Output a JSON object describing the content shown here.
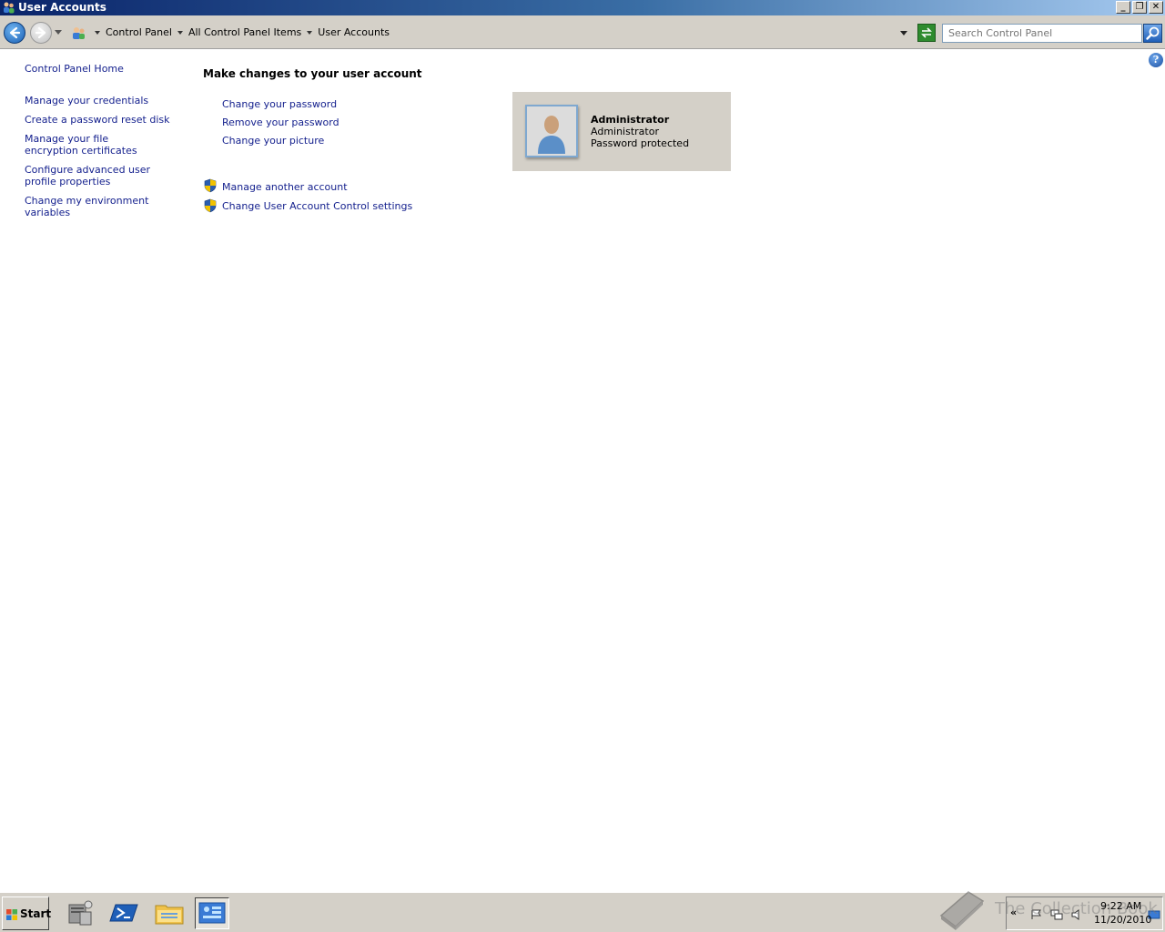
{
  "window": {
    "title": "User Accounts",
    "buttons": {
      "minimize": "_",
      "restore": "❐",
      "close": "✕"
    }
  },
  "address_bar": {
    "breadcrumbs": [
      "Control Panel",
      "All Control Panel Items",
      "User Accounts"
    ],
    "search_placeholder": "Search Control Panel"
  },
  "sidebar": {
    "home": "Control Panel Home",
    "items": [
      "Manage your credentials",
      "Create a password reset disk",
      "Manage your file encryption certificates",
      "Configure advanced user profile properties",
      "Change my environment variables"
    ]
  },
  "main": {
    "heading": "Make changes to your user account",
    "tasks": [
      "Change your password",
      "Remove your password",
      "Change your picture"
    ],
    "admin_tasks": [
      "Manage another account",
      "Change User Account Control settings"
    ]
  },
  "account": {
    "name": "Administrator",
    "role": "Administrator",
    "status": "Password protected"
  },
  "help": {
    "glyph": "?"
  },
  "taskbar": {
    "start_label": "Start",
    "apps": [
      "server-manager-icon",
      "powershell-icon",
      "explorer-icon",
      "control-panel-icon"
    ],
    "active_app": "control-panel-icon",
    "clock_time": "9:22 AM",
    "clock_date": "11/20/2010",
    "watermark": "The Collection Book"
  },
  "colors": {
    "link": "#15218e",
    "chrome": "#d4d0c8",
    "card": "#d4d0c8"
  }
}
